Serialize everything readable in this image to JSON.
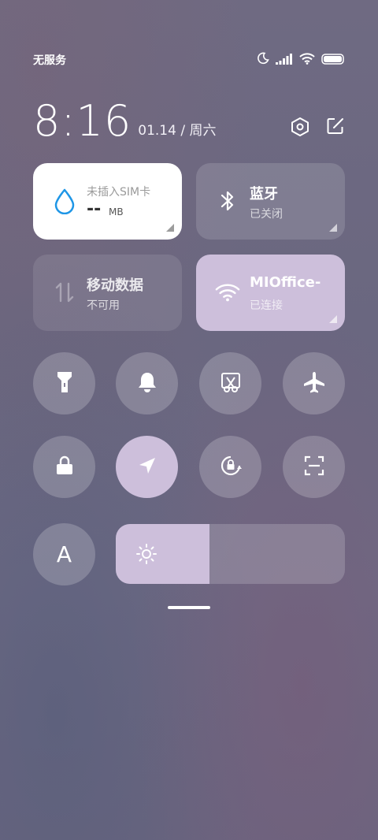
{
  "status_bar": {
    "carrier": "无服务",
    "icons": [
      "moon-icon",
      "signal-icon",
      "wifi-icon",
      "battery-icon"
    ]
  },
  "header": {
    "time": "8:16",
    "date": "01.14 / 周六",
    "icons": [
      "settings-icon",
      "edit-icon"
    ]
  },
  "tiles": {
    "data_usage": {
      "label": "未插入SIM卡",
      "value": "--",
      "unit": "MB",
      "icon": "water-drop-icon",
      "accent": "#1e96e6"
    },
    "bluetooth": {
      "title": "蓝牙",
      "status": "已关闭",
      "icon": "bluetooth-icon"
    },
    "mobile_data": {
      "title": "移动数据",
      "status": "不可用",
      "icon": "data-arrows-icon"
    },
    "wifi": {
      "title": "MIOffice-",
      "status": "已连接",
      "icon": "wifi-icon"
    }
  },
  "toggles_row1": [
    "flashlight-icon",
    "bell-icon",
    "screenshot-icon",
    "airplane-icon"
  ],
  "toggles_row2": [
    "lock-icon",
    "location-icon",
    "rotation-lock-icon",
    "scan-icon"
  ],
  "font_toggle": {
    "label": "A"
  },
  "brightness": {
    "level": 0.41,
    "icon": "sun-icon"
  },
  "colors": {
    "active": "#cdbfdb",
    "inactive": "rgba(255,255,255,0.2)"
  }
}
